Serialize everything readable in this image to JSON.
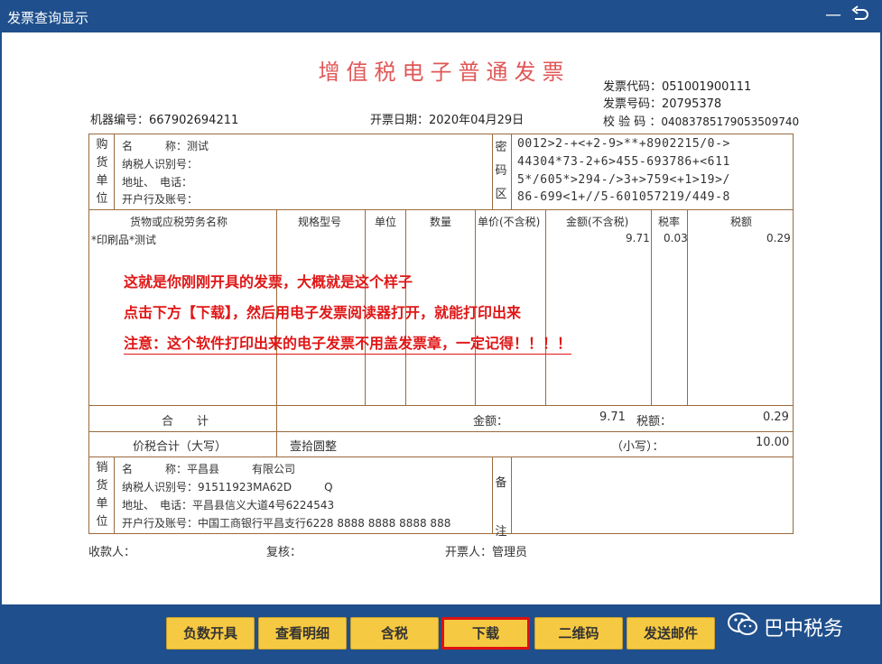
{
  "window": {
    "title": "发票查询显示"
  },
  "invoice": {
    "title": "增值税电子普通发票",
    "code_label": "发票代码：",
    "code": "051001900111",
    "number_label": "发票号码：",
    "number": "20795378",
    "check_label": "校 验 码 ：",
    "check": "04083785179053509740",
    "machine_label": "机器编号：",
    "machine": "667902694211",
    "date_label": "开票日期：",
    "date": "2020年04月29日"
  },
  "buyer": {
    "side": [
      "购",
      "货",
      "单",
      "位"
    ],
    "name_label": "名　　　称：",
    "name": "测试",
    "taxid_label": "纳税人识别号：",
    "addr_label": "地址、　电话：",
    "bank_label": "开户行及账号："
  },
  "cipher": {
    "side": [
      "密",
      "码",
      "区"
    ],
    "lines": [
      "0012>2-+<+2-9>**+8902215/0->",
      "44304*73-2+6>455-693786+<611",
      "5*/605*>294-/>3+>759<+1>19>/",
      "86-699<1+//5-601057219/449-8"
    ]
  },
  "items": {
    "headers": [
      "货物或应税劳务名称",
      "规格型号",
      "单位",
      "数量",
      "单价(不含税)",
      "金额(不含税)",
      "税率",
      "税额"
    ],
    "rows": [
      {
        "name": "*印刷品*测试",
        "amount": "9.71",
        "rate": "0.03",
        "tax": "0.29"
      }
    ]
  },
  "annotation": {
    "line1": "这就是你刚刚开具的发票，大概就是这个样子",
    "line2": "点击下方【下载】，然后用电子发票阅读器打开，就能打印出来",
    "line3": "注意：这个软件打印出来的电子发票不用盖发票章，一定记得！！！！"
  },
  "totals": {
    "label": "合　　计",
    "amount_label": "金额：",
    "amount": "9.71",
    "tax_label": "税额：",
    "tax": "0.29",
    "combined_label": "价税合计（大写）",
    "combined_upper": "壹拾圆整",
    "small_label": "（小写）：",
    "combined_small": "10.00"
  },
  "seller": {
    "side": [
      "销",
      "货",
      "单",
      "位"
    ],
    "name_label": "名　　　称：",
    "name": "平昌县　　　有限公司",
    "taxid_label": "纳税人识别号：",
    "taxid": "91511923MA62D　　　Q",
    "addr_label": "地址、　电话：",
    "addr": "平昌县信义大道4号6224543",
    "bank_label": "开户行及账号：",
    "bank": "中国工商银行平昌支行6228 8888 8888 8888 888"
  },
  "remarks": {
    "side": [
      "备",
      "注"
    ]
  },
  "footer": {
    "payee_label": "收款人：",
    "reviewer_label": "复核：",
    "drawer_label": "开票人：",
    "drawer": "管理员"
  },
  "toolbar": {
    "buttons": [
      "负数开具",
      "查看明细",
      "含税",
      "下载",
      "二维码",
      "发送邮件"
    ],
    "brand": "巴中税务"
  },
  "colors": {
    "frame": "#1f4f8c",
    "title_red": "#e05757",
    "note_red": "#e01717",
    "button": "#f6c942"
  }
}
